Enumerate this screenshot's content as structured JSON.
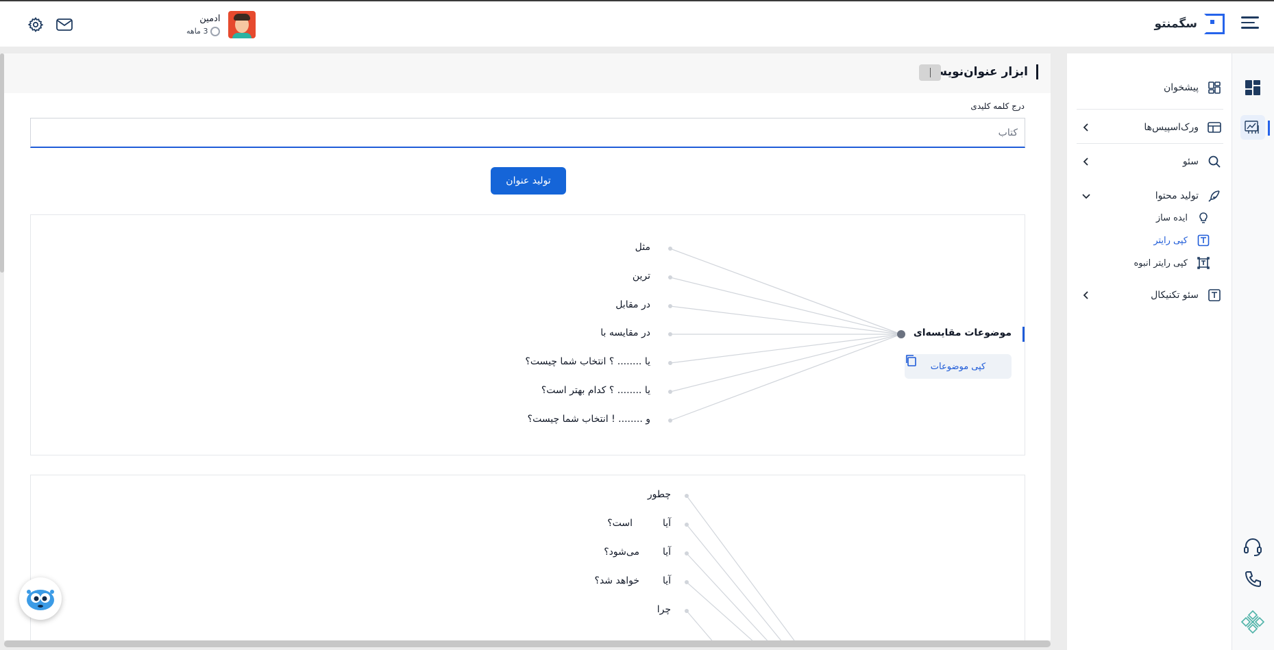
{
  "header": {
    "brand_name": "سگمنتو",
    "user_name": "ادمین",
    "user_plan": "3 ماهه"
  },
  "icons": {
    "menu": "hamburger-menu-icon",
    "brand": "segmento-logo",
    "mail": "mail-icon",
    "settings": "gear-icon",
    "dashboard": "dashboard-icon",
    "workspace": "workspace-icon",
    "search": "search-icon",
    "feather": "feather-icon",
    "bulb": "lightbulb-icon",
    "text": "text-t-icon",
    "bulk": "bulk-text-icon",
    "support": "headset-icon",
    "phone": "phone-icon"
  },
  "sidebar": {
    "items": [
      {
        "label": "پیشخوان"
      },
      {
        "label": "ورک‌اسپیس‌ها"
      },
      {
        "label": "سئو"
      },
      {
        "label": "تولید محتوا"
      },
      {
        "label": "سئو تکنیکال"
      }
    ],
    "sub_items": [
      {
        "label": "ایده ساز"
      },
      {
        "label": "کپی رایتر"
      },
      {
        "label": "کپی رایتر انبوه"
      }
    ]
  },
  "main": {
    "title": "ابزار عنوان‌نویس",
    "field_label": "درج کلمه کلیدی",
    "keyword_value": "کتاب",
    "generate_button": "تولید عنوان"
  },
  "panel1": {
    "root": "موضوعات مقایسه‌ای",
    "copy_button": "کپی موضوعات",
    "leaves": [
      "مثل",
      "ترین",
      "در مقابل",
      "در مقایسه با",
      "یا ........ ؟ انتخاب شما چیست؟",
      "یا ........ ؟ کدام بهتر است؟",
      "و ........ ! انتخاب شما چیست؟"
    ]
  },
  "panel2": {
    "leaves": [
      {
        "a": "چطور",
        "b": ""
      },
      {
        "a": "آیا",
        "b": "است؟"
      },
      {
        "a": "آیا",
        "b": "می‌شود؟"
      },
      {
        "a": "آیا",
        "b": "خواهد شد؟"
      },
      {
        "a": "چرا",
        "b": ""
      }
    ]
  },
  "colors": {
    "accent": "#1565d8",
    "connector": "#d1d5db"
  }
}
